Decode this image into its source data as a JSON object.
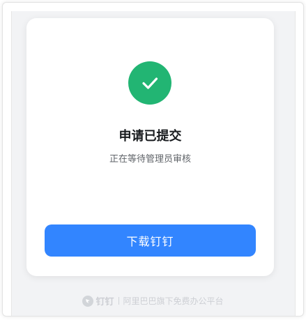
{
  "status": {
    "title": "申请已提交",
    "subtitle": "正在等待管理员审核",
    "icon": "check-icon",
    "icon_color": "#22b573"
  },
  "actions": {
    "download_label": "下载钉钉",
    "button_color": "#3285ff"
  },
  "footer": {
    "brand": "钉钉",
    "tagline": "阿里巴巴旗下免费办公平台"
  }
}
